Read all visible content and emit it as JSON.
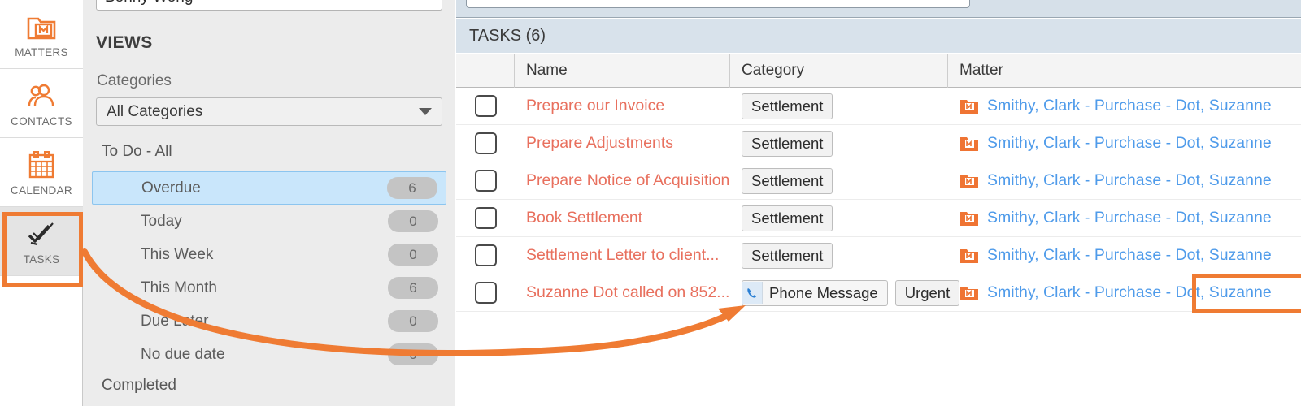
{
  "rail": {
    "items": [
      {
        "label": "MATTERS",
        "icon": "matters-folder-icon",
        "active": false
      },
      {
        "label": "CONTACTS",
        "icon": "contacts-people-icon",
        "active": false
      },
      {
        "label": "CALENDAR",
        "icon": "calendar-icon",
        "active": false
      },
      {
        "label": "TASKS",
        "icon": "tasks-checkmark-icon",
        "active": true
      }
    ]
  },
  "views": {
    "user_select": {
      "value": "Bonny Wong",
      "caret_icon": "chevron-down-icon"
    },
    "title": "VIEWS",
    "categories_label": "Categories",
    "categories_select": {
      "value": "All Categories",
      "arrow_icon": "chevron-down-icon"
    },
    "todo_group": "To Do - All",
    "completed_group": "Completed",
    "items": [
      {
        "label": "Overdue",
        "count": "6",
        "selected": true
      },
      {
        "label": "Today",
        "count": "0",
        "selected": false
      },
      {
        "label": "This Week",
        "count": "0",
        "selected": false
      },
      {
        "label": "This Month",
        "count": "6",
        "selected": false
      },
      {
        "label": "Due Later",
        "count": "0",
        "selected": false
      },
      {
        "label": "No due date",
        "count": "0",
        "selected": false
      }
    ]
  },
  "tasks_panel": {
    "header": "TASKS (6)",
    "columns": {
      "select": "",
      "name": "Name",
      "category": "Category",
      "matter": "Matter"
    },
    "rows": [
      {
        "checked": false,
        "name": "Prepare our Invoice",
        "badges": [
          {
            "label": "Settlement",
            "icon": null
          }
        ],
        "matter": "Smithy, Clark - Purchase - Dot, Suzanne",
        "matter_icon": "matter-folder-icon"
      },
      {
        "checked": false,
        "name": "Prepare Adjustments",
        "badges": [
          {
            "label": "Settlement",
            "icon": null
          }
        ],
        "matter": "Smithy, Clark - Purchase - Dot, Suzanne",
        "matter_icon": "matter-folder-icon"
      },
      {
        "checked": false,
        "name": "Prepare Notice of Acquisition",
        "badges": [
          {
            "label": "Settlement",
            "icon": null
          }
        ],
        "matter": "Smithy, Clark - Purchase - Dot, Suzanne",
        "matter_icon": "matter-folder-icon"
      },
      {
        "checked": false,
        "name": "Book Settlement",
        "badges": [
          {
            "label": "Settlement",
            "icon": null
          }
        ],
        "matter": "Smithy, Clark - Purchase - Dot, Suzanne",
        "matter_icon": "matter-folder-icon"
      },
      {
        "checked": false,
        "name": "Settlement Letter to client...",
        "badges": [
          {
            "label": "Settlement",
            "icon": null
          }
        ],
        "matter": "Smithy, Clark - Purchase - Dot, Suzanne",
        "matter_icon": "matter-folder-icon"
      },
      {
        "checked": false,
        "name": "Suzanne Dot called on 852...",
        "badges": [
          {
            "label": "Phone Message",
            "icon": "phone-icon"
          },
          {
            "label": "Urgent",
            "icon": null
          }
        ],
        "matter": "Smithy, Clark - Purchase - Dot, Suzanne",
        "matter_icon": "matter-folder-icon"
      }
    ]
  },
  "annotation": {
    "highlight_color": "#ef7b33",
    "arrow_color": "#ef7b33",
    "highlighted_elements": [
      "tasks-rail-button",
      "phone-message-badge"
    ]
  },
  "colors": {
    "accent_orange": "#ef7b33",
    "task_name_red": "#e8705e",
    "matter_link_blue": "#4f9bea",
    "selected_row_blue": "#c9e6fb",
    "panel_gray": "#ececec",
    "tasks_bar_blue": "#d8e2eb"
  }
}
